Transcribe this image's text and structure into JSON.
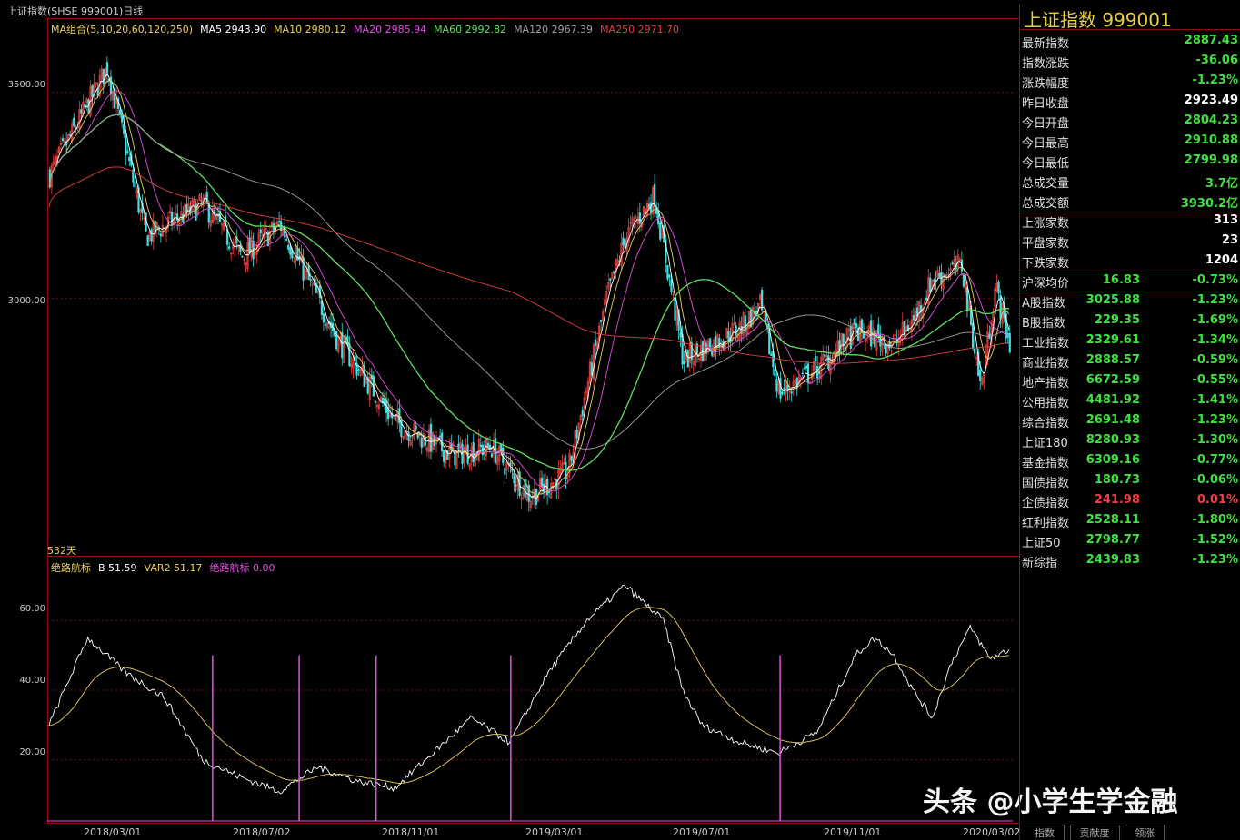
{
  "header": {
    "title": "上证指数(SHSE 999001)日线"
  },
  "ma_legend": [
    {
      "label": "MA组合(5,10,20,60,120,250)",
      "color": "#e8d060"
    },
    {
      "label": "MA5 2943.90",
      "color": "#ffffff"
    },
    {
      "label": "MA10 2980.12",
      "color": "#e8d060"
    },
    {
      "label": "MA20 2985.94",
      "color": "#e050e0"
    },
    {
      "label": "MA60 2992.82",
      "color": "#60e060"
    },
    {
      "label": "MA120 2967.39",
      "color": "#a0a0a0"
    },
    {
      "label": "MA250 2971.70",
      "color": "#e04040"
    }
  ],
  "price_axis": [
    "3500.00",
    "3000.00"
  ],
  "days_label": "532天",
  "indicator_legend": [
    {
      "label": "绝路航标",
      "color": "#e8d060"
    },
    {
      "label": "B 51.59",
      "color": "#ffffff"
    },
    {
      "label": "VAR2 51.17",
      "color": "#e8d060"
    },
    {
      "label": "绝路航标 0.00",
      "color": "#e050e0"
    }
  ],
  "indicator_axis": [
    "60.00",
    "40.00",
    "20.00"
  ],
  "x_axis": [
    "2018/03/01",
    "2018/07/02",
    "2018/11/01",
    "2019/03/01",
    "2019/07/01",
    "2019/11/01",
    "2020/03/02"
  ],
  "panel": {
    "title": "上证指数  999001",
    "rows": [
      {
        "label": "最新指数",
        "value": "2887.43",
        "color": "#40e040"
      },
      {
        "label": "指数涨跌",
        "value": "-36.06",
        "color": "#40e040"
      },
      {
        "label": "涨跌幅度",
        "value": "-1.23%",
        "color": "#40e040"
      },
      {
        "label": "昨日收盘",
        "value": "2923.49",
        "color": "#ffffff"
      },
      {
        "label": "今日开盘",
        "value": "2804.23",
        "color": "#40e040"
      },
      {
        "label": "今日最高",
        "value": "2910.88",
        "color": "#40e040"
      },
      {
        "label": "今日最低",
        "value": "2799.98",
        "color": "#40e040"
      },
      {
        "label": "总成交量",
        "value": "3.7亿",
        "color": "#40e040"
      },
      {
        "label": "总成交额",
        "value": "3930.2亿",
        "color": "#40e040"
      }
    ],
    "counts": [
      {
        "label": "上涨家数",
        "value": "313",
        "color": "#ffffff"
      },
      {
        "label": "平盘家数",
        "value": "23",
        "color": "#ffffff"
      },
      {
        "label": "下跌家数",
        "value": "1204",
        "color": "#ffffff"
      }
    ],
    "avg": {
      "label": "沪深均价",
      "mid": "16.83",
      "value": "-0.73%"
    },
    "indices": [
      {
        "label": "A股指数",
        "mid": "3025.88",
        "value": "-1.23%",
        "color": "#40e040"
      },
      {
        "label": "B股指数",
        "mid": "229.35",
        "value": "-1.69%",
        "color": "#40e040"
      },
      {
        "label": "工业指数",
        "mid": "2329.61",
        "value": "-1.34%",
        "color": "#40e040"
      },
      {
        "label": "商业指数",
        "mid": "2888.57",
        "value": "-0.59%",
        "color": "#40e040"
      },
      {
        "label": "地产指数",
        "mid": "6672.59",
        "value": "-0.55%",
        "color": "#40e040"
      },
      {
        "label": "公用指数",
        "mid": "4481.92",
        "value": "-1.41%",
        "color": "#40e040"
      },
      {
        "label": "综合指数",
        "mid": "2691.48",
        "value": "-1.23%",
        "color": "#40e040"
      },
      {
        "label": "上证180",
        "mid": "8280.93",
        "value": "-1.30%",
        "color": "#40e040"
      },
      {
        "label": "基金指数",
        "mid": "6309.16",
        "value": "-0.77%",
        "color": "#40e040"
      },
      {
        "label": "国债指数",
        "mid": "180.73",
        "value": "-0.06%",
        "color": "#40e040"
      },
      {
        "label": "企债指数",
        "mid": "241.98",
        "value": "0.01%",
        "color": "#f04040"
      },
      {
        "label": "红利指数",
        "mid": "2528.11",
        "value": "-1.80%",
        "color": "#40e040"
      },
      {
        "label": "上证50",
        "mid": "2798.77",
        "value": "-1.52%",
        "color": "#40e040"
      },
      {
        "label": "新综指",
        "mid": "2439.83",
        "value": "-1.23%",
        "color": "#40e040"
      }
    ]
  },
  "tabs": [
    "指数",
    "贡献度",
    "领涨"
  ],
  "watermark": "头条 @小学生学金融",
  "colors": {
    "up": "#f04040",
    "down": "#40e0e0",
    "frame": "#8a1010"
  }
}
